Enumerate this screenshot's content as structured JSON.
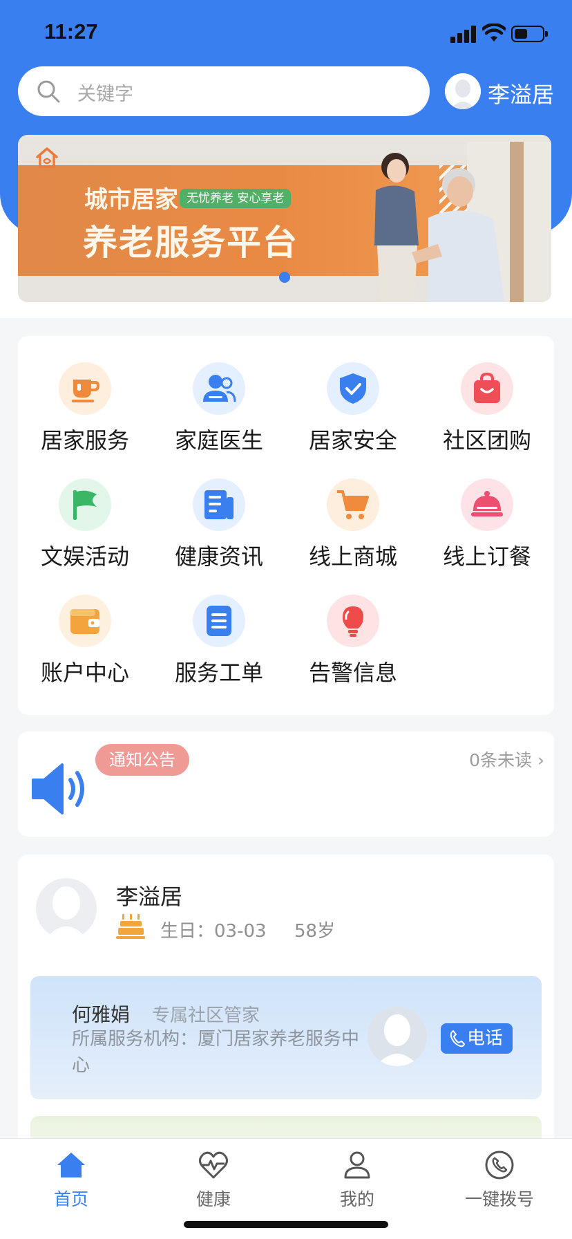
{
  "status_bar": {
    "time": "11:27"
  },
  "header": {
    "search_placeholder": "关键字",
    "user_name": "李溢居"
  },
  "banner": {
    "line1": "城市居家",
    "tag": "无忧养老 安心享老",
    "line2": "养老服务平台"
  },
  "services": [
    {
      "label": "居家服务",
      "icon": "cup-icon",
      "bg": "#fdeede",
      "color": "#ef8a3c"
    },
    {
      "label": "家庭医生",
      "icon": "doctor-icon",
      "bg": "#e4efff",
      "color": "#3a7ff0"
    },
    {
      "label": "居家安全",
      "icon": "shield-icon",
      "bg": "#e4efff",
      "color": "#3a7ff0"
    },
    {
      "label": "社区团购",
      "icon": "shopping-bag-icon",
      "bg": "#fde3e3",
      "color": "#ee4e56"
    },
    {
      "label": "文娱活动",
      "icon": "flag-icon",
      "bg": "#e2f7ea",
      "color": "#3bb665"
    },
    {
      "label": "健康资讯",
      "icon": "news-icon",
      "bg": "#e4efff",
      "color": "#3a7ff0"
    },
    {
      "label": "线上商城",
      "icon": "cart-icon",
      "bg": "#fdeede",
      "color": "#f08a3c"
    },
    {
      "label": "线上订餐",
      "icon": "food-cover-icon",
      "bg": "#fde3e8",
      "color": "#ee4e70"
    },
    {
      "label": "账户中心",
      "icon": "wallet-icon",
      "bg": "#fdf0de",
      "color": "#f3a43c"
    },
    {
      "label": "服务工单",
      "icon": "list-icon",
      "bg": "#e4efff",
      "color": "#3a7ff0"
    },
    {
      "label": "告警信息",
      "icon": "alarm-icon",
      "bg": "#fde3e3",
      "color": "#ee4a4a"
    }
  ],
  "notice": {
    "badge": "通知公告",
    "unread": "0条未读 ›"
  },
  "profile": {
    "name": "李溢居",
    "birthday": "生日：03-03",
    "age": "58岁",
    "manager": {
      "name": "何雅娟",
      "role": "专属社区管家",
      "org": "所属服务机构：厦门居家养老服务中心",
      "call_label": "电话"
    }
  },
  "tabbar": [
    {
      "label": "首页",
      "icon": "home-icon",
      "active": true
    },
    {
      "label": "健康",
      "icon": "heart-pulse-icon",
      "active": false
    },
    {
      "label": "我的",
      "icon": "person-icon",
      "active": false
    },
    {
      "label": "一键拨号",
      "icon": "phone-icon",
      "active": false
    }
  ],
  "colors": {
    "primary": "#3a7ff0",
    "notice_badge": "#f09a96"
  }
}
